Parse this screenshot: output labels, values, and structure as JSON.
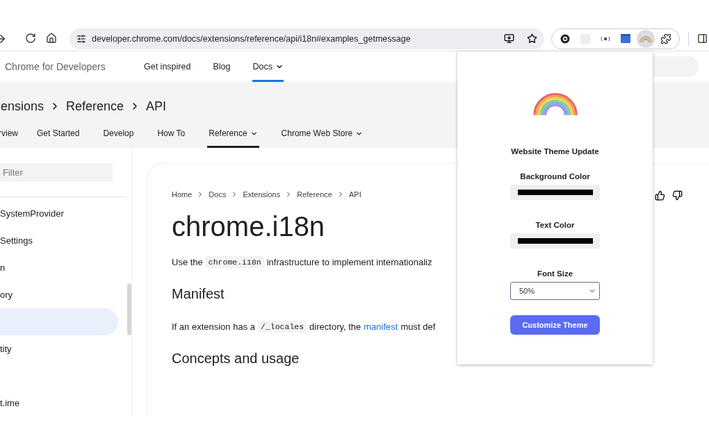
{
  "browser": {
    "url": "developer.chrome.com/docs/extensions/reference/api/i18n#examples_getmessage",
    "extensions": [
      {
        "kind": "circle",
        "selected": false
      },
      {
        "kind": "blank",
        "selected": false
      },
      {
        "kind": "signal",
        "selected": false
      },
      {
        "kind": "calendar",
        "selected": false
      },
      {
        "kind": "rainbow",
        "selected": true
      },
      {
        "kind": "puzzle",
        "selected": false
      }
    ]
  },
  "site_header": {
    "brand": "Chrome for Developers",
    "nav": [
      {
        "label": "Get inspired",
        "selected": false,
        "dropdown": false
      },
      {
        "label": "Blog",
        "selected": false,
        "dropdown": false
      },
      {
        "label": "Docs",
        "selected": true,
        "dropdown": true
      }
    ]
  },
  "section": {
    "breadcrumb": [
      "ensions",
      "Reference",
      "API"
    ],
    "tabs": [
      {
        "label": "rview",
        "selected": false,
        "dropdown": false
      },
      {
        "label": "Get Started",
        "selected": false,
        "dropdown": false
      },
      {
        "label": "Develop",
        "selected": false,
        "dropdown": false
      },
      {
        "label": "How To",
        "selected": false,
        "dropdown": false
      },
      {
        "label": "Reference",
        "selected": true,
        "dropdown": true
      },
      {
        "label": "Chrome Web Store",
        "selected": false,
        "dropdown": true
      }
    ]
  },
  "sidebar": {
    "filter": {
      "placeholder": "Filter"
    },
    "items": [
      {
        "kind": "item",
        "label": "SystemProvider",
        "selected": false
      },
      {
        "kind": "item",
        "label": "Settings",
        "selected": false
      },
      {
        "kind": "item",
        "label": "n",
        "selected": false
      },
      {
        "kind": "item",
        "label": "ory",
        "selected": false
      },
      {
        "kind": "item",
        "selected": true
      },
      {
        "kind": "item",
        "label": "tity",
        "selected": false
      },
      {
        "kind": "gap"
      },
      {
        "kind": "item",
        "label": "t.ime",
        "selected": false
      }
    ]
  },
  "article": {
    "breadcrumb": [
      "Home",
      "Docs",
      "Extensions",
      "Reference",
      "API"
    ],
    "title": "chrome.i18n",
    "blocks": [
      {
        "kind": "paragraph",
        "parts": [
          {
            "kind": "text",
            "text": "Use the"
          },
          {
            "kind": "code",
            "text": "chrome.i18n"
          },
          {
            "kind": "text",
            "text": "infrastructure to implement internationaliz"
          }
        ]
      },
      {
        "kind": "heading",
        "text": "Manifest"
      },
      {
        "kind": "paragraph",
        "parts": [
          {
            "kind": "text",
            "text": "If an extension has a"
          },
          {
            "kind": "code",
            "text": "/_locales"
          },
          {
            "kind": "text",
            "text": "directory, the"
          },
          {
            "kind": "link",
            "text": "manifest"
          },
          {
            "kind": "text",
            "text": "must def"
          }
        ]
      },
      {
        "kind": "heading",
        "text": "Concepts and usage"
      }
    ]
  },
  "popup": {
    "title": "Website Theme Update",
    "fields": [
      {
        "kind": "color",
        "label": "Background Color",
        "color": "#000000"
      },
      {
        "kind": "color",
        "label": "Text Color",
        "color": "#000000"
      },
      {
        "kind": "select",
        "label": "Font Size",
        "value": "50%"
      }
    ],
    "button": "Customize Theme"
  }
}
